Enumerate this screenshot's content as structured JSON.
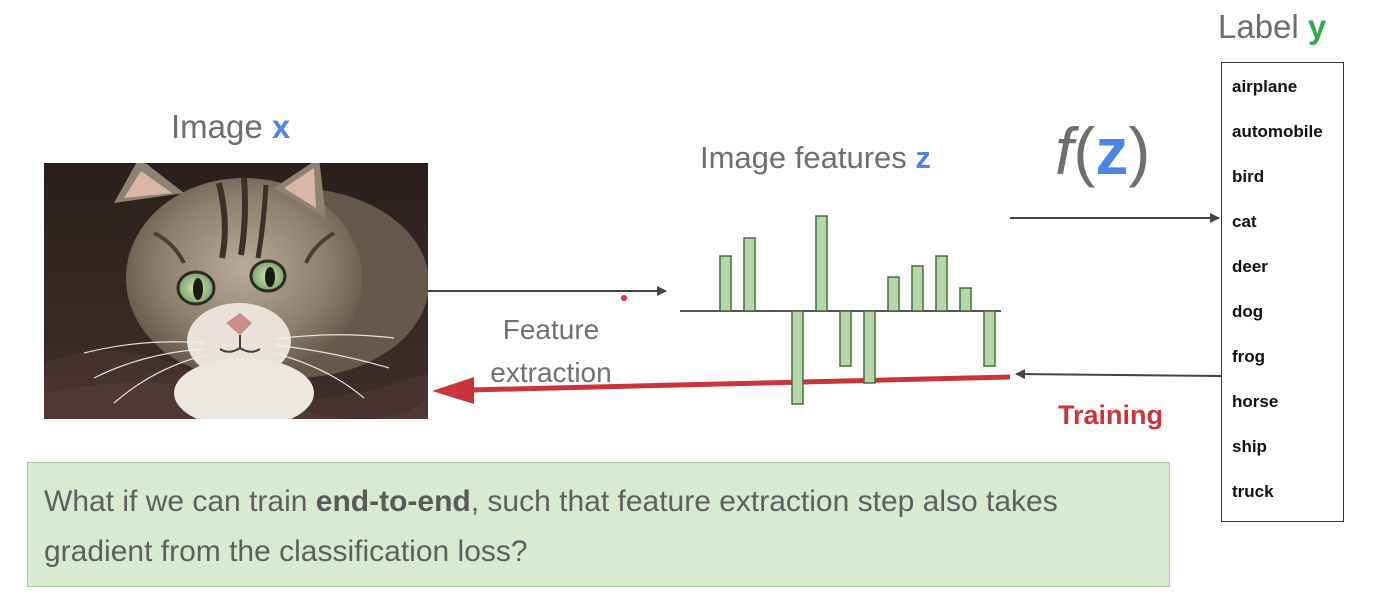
{
  "image_title": {
    "text": "Image ",
    "var": "x",
    "var_color": "#4a86e8"
  },
  "features_title": {
    "text": "Image features ",
    "var": "z",
    "var_color": "#4a86e8"
  },
  "label_title": {
    "text": "Label ",
    "var": "y",
    "var_color": "#34a853"
  },
  "function": {
    "f": "f",
    "open": "(",
    "z": "z",
    "close": ")",
    "z_color": "#4a86e8"
  },
  "labels": [
    "airplane",
    "automobile",
    "bird",
    "cat",
    "deer",
    "dog",
    "frog",
    "horse",
    "ship",
    "truck"
  ],
  "feature_extraction_label": {
    "line1": "Feature",
    "line2": "extraction"
  },
  "training_label": "Training",
  "feature_values": [
    0.55,
    0.73,
    0,
    -0.93,
    0.95,
    -0.55,
    -0.72,
    0.34,
    0.45,
    0.55,
    0.23,
    -0.55
  ],
  "question": {
    "before": "What if we can train ",
    "bold": "end-to-end",
    "after": ", such that feature extraction step also takes gradient from the classification loss?"
  },
  "colors": {
    "bar_fill": "#b6d7a8",
    "bar_stroke": "#4f6b45",
    "arrow": "#444444",
    "training_arrow": "#c9353a",
    "question_bg": "#d9ead3"
  }
}
